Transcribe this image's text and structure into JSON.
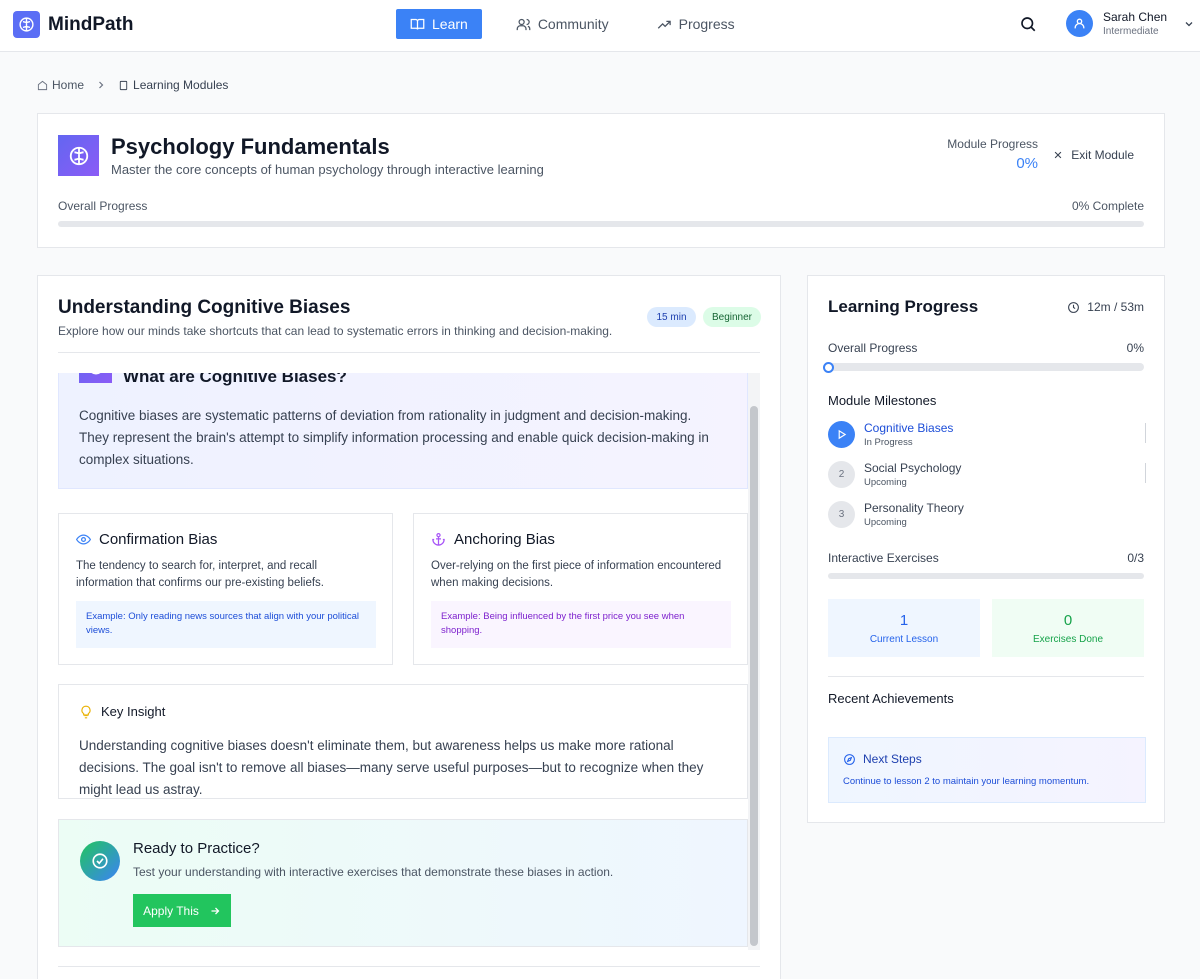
{
  "app": {
    "name": "MindPath"
  },
  "nav": {
    "items": [
      {
        "label": "Learn",
        "active": true
      },
      {
        "label": "Community",
        "active": false
      },
      {
        "label": "Progress",
        "active": false
      }
    ]
  },
  "user": {
    "name": "Sarah Chen",
    "role": "Intermediate"
  },
  "breadcrumb": {
    "home": "Home",
    "current": "Learning Modules"
  },
  "module": {
    "title": "Psychology Fundamentals",
    "subtitle": "Master the core concepts of human psychology through interactive learning",
    "progress_label": "Module Progress",
    "progress_value": "0%",
    "exit_label": "Exit Module",
    "overall_label": "Overall Progress",
    "overall_value": "0% Complete",
    "overall_fraction": 0
  },
  "lesson": {
    "title": "Understanding Cognitive Biases",
    "subtitle": "Explore how our minds take shortcuts that can lead to systematic errors in thinking and decision-making.",
    "duration": "15 min",
    "level": "Beginner",
    "intro": {
      "heading": "What are Cognitive Biases?",
      "text": "Cognitive biases are systematic patterns of deviation from rationality in judgment and decision-making. They represent the brain's attempt to simplify information processing and enable quick decision-making in complex situations."
    },
    "biases": [
      {
        "title": "Confirmation Bias",
        "icon": "eye-icon",
        "text": "The tendency to search for, interpret, and recall information that confirms our pre-existing beliefs.",
        "example": "Example: Only reading news sources that align with your political views."
      },
      {
        "title": "Anchoring Bias",
        "icon": "anchor-icon",
        "text": "Over-relying on the first piece of information encountered when making decisions.",
        "example": "Example: Being influenced by the first price you see when shopping."
      }
    ],
    "insight": {
      "heading": "Key Insight",
      "text": "Understanding cognitive biases doesn't eliminate them, but awareness helps us make more rational decisions. The goal isn't to remove all biases—many serve useful purposes—but to recognize when they might lead us astray."
    },
    "practice": {
      "heading": "Ready to Practice?",
      "text": "Test your understanding with interactive exercises that demonstrate these biases in action.",
      "button": "Apply This"
    }
  },
  "sidebar": {
    "title": "Learning Progress",
    "time": "12m / 53m",
    "overall_label": "Overall Progress",
    "overall_value": "0%",
    "milestones_heading": "Module Milestones",
    "milestones": [
      {
        "marker": "",
        "name": "Cognitive Biases",
        "status": "In Progress",
        "active": true
      },
      {
        "marker": "2",
        "name": "Social Psychology",
        "status": "Upcoming",
        "active": false
      },
      {
        "marker": "3",
        "name": "Personality Theory",
        "status": "Upcoming",
        "active": false
      }
    ],
    "exercises_label": "Interactive Exercises",
    "exercises_value": "0/3",
    "stats": [
      {
        "value": "1",
        "label": "Current Lesson"
      },
      {
        "value": "0",
        "label": "Exercises Done"
      }
    ],
    "achievements_heading": "Recent Achievements",
    "next_steps": {
      "heading": "Next Steps",
      "text": "Continue to lesson 2 to maintain your learning momentum."
    }
  },
  "colors": {
    "accent": "#3b82f6",
    "brand": "#5b6ef5",
    "success": "#22c55e"
  }
}
